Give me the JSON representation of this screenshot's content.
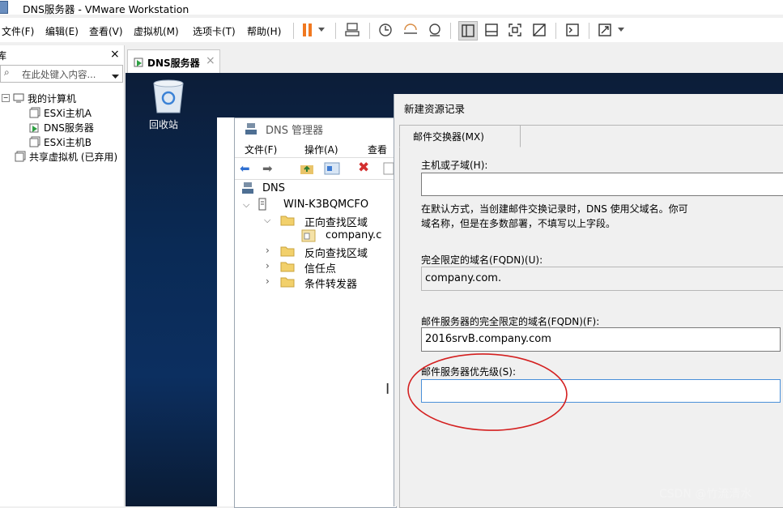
{
  "window": {
    "title": "DNS服务器 - VMware Workstation"
  },
  "menubar": {
    "items": [
      "文件(F)",
      "编辑(E)",
      "查看(V)",
      "虚拟机(M)",
      "选项卡(T)",
      "帮助(H)"
    ]
  },
  "library": {
    "title_fragment": "库",
    "search_placeholder": "在此处键入内容...",
    "tree": {
      "root": "我的计算机",
      "vm1": "ESXi主机A",
      "vm2": "DNS服务器",
      "vm3": "ESXi主机B",
      "shared": "共享虚拟机 (已弃用)"
    }
  },
  "tabs": {
    "active": "DNS服务器"
  },
  "desktop": {
    "recycle_bin": "回收站"
  },
  "dns_manager": {
    "title": "DNS 管理器",
    "menu": [
      "文件(F)",
      "操作(A)",
      "查看"
    ],
    "tree": {
      "root": "DNS",
      "server": "WIN-K3BQMCFO",
      "forward": "正向查找区域",
      "zone": "company.c",
      "reverse": "反向查找区域",
      "trust": "信任点",
      "forwarders": "条件转发器"
    }
  },
  "dialog": {
    "title": "新建资源记录",
    "tab": "邮件交换器(MX)",
    "host_label": "主机或子域(H):",
    "host_value": "",
    "hint_line1": "在默认方式，当创建邮件交换记录时，DNS 使用父域名。你可",
    "hint_line2": "域名称，但是在多数部署，不填写以上字段。",
    "fqdn_label": "完全限定的域名(FQDN)(U):",
    "fqdn_value": "company.com.",
    "mailserver_label": "邮件服务器的完全限定的域名(FQDN)(F):",
    "mailserver_value": "2016srvB.company.com",
    "priority_label": "邮件服务器优先级(S):",
    "priority_value": ""
  },
  "watermark": "CSDN @竹流清水",
  "colors": {
    "annotation_circle": "#d42020",
    "desktop": "#0c2a55",
    "pause_icon": "#f07820"
  }
}
